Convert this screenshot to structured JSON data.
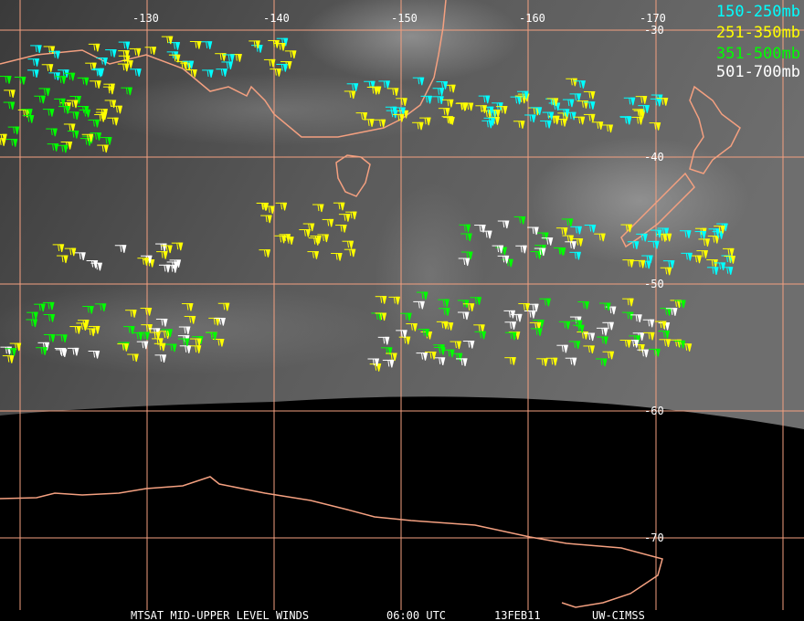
{
  "legend": [
    {
      "label": "150-250mb",
      "color": "#00ffff"
    },
    {
      "label": "251-350mb",
      "color": "#ffff00"
    },
    {
      "label": "351-500mb",
      "color": "#00ff00"
    },
    {
      "label": "501-700mb",
      "color": "#ffffff"
    }
  ],
  "longitude_labels": [
    "-130",
    "-140",
    "-150",
    "-160",
    "-170"
  ],
  "latitude_labels": [
    "-30",
    "-40",
    "-50",
    "-60",
    "-70"
  ],
  "footer": {
    "product": "MTSAT MID-UPPER LEVEL WINDS",
    "time": "06:00 UTC",
    "date": "13FEB11",
    "source": "UW-CIMSS"
  },
  "colors": {
    "grid": "#f4a080",
    "coast": "#f4a080"
  }
}
